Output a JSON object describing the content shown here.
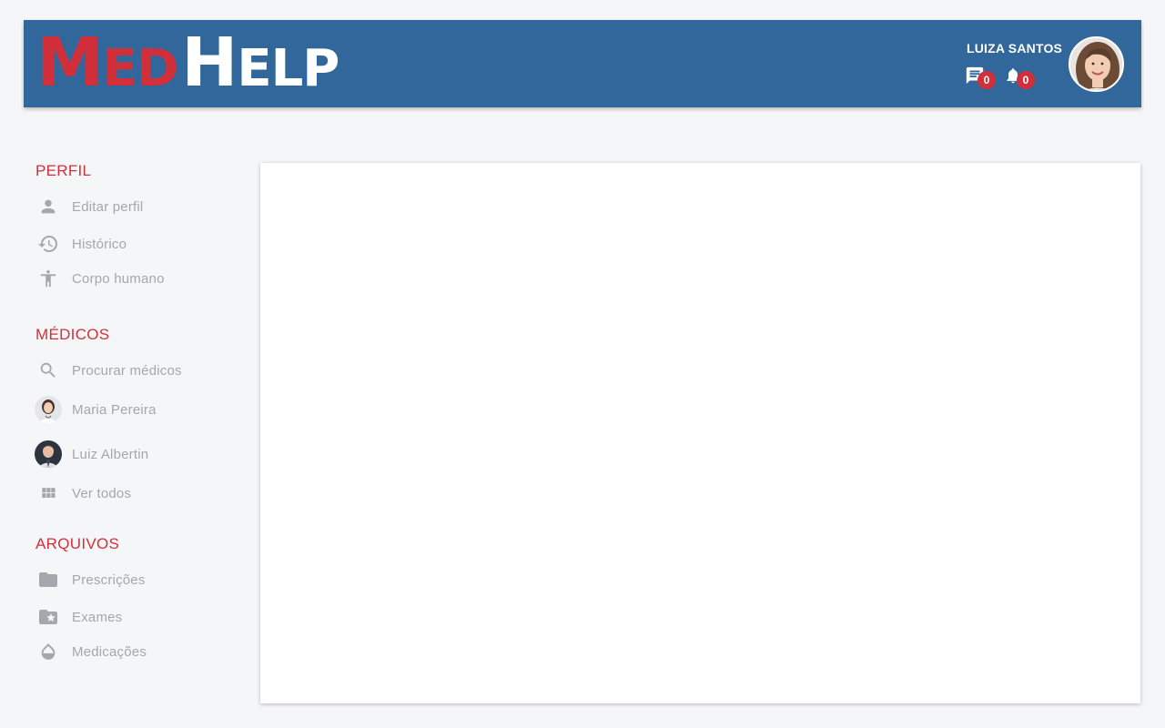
{
  "header": {
    "logo": {
      "part1": "Med",
      "part2": "Help"
    },
    "user_name": "LUIZA SANTOS",
    "messages": {
      "icon": "chat-icon",
      "count": "0"
    },
    "notifications": {
      "icon": "bell-icon",
      "count": "0"
    },
    "avatar": "user-avatar"
  },
  "sidebar": {
    "sections": [
      {
        "title": "PERFIL",
        "items": [
          {
            "label": "Editar perfil",
            "icon": "person-icon"
          },
          {
            "label": "Histórico",
            "icon": "history-icon"
          },
          {
            "label": "Corpo humano",
            "icon": "accessibility-icon"
          }
        ]
      },
      {
        "title": "MÉDICOS",
        "items": [
          {
            "label": "Procurar médicos",
            "icon": "search-icon"
          },
          {
            "label": "Maria Pereira",
            "icon": "doctor-avatar"
          },
          {
            "label": "Luiz Albertin",
            "icon": "doctor-avatar"
          },
          {
            "label": "Ver todos",
            "icon": "grid-icon"
          }
        ]
      },
      {
        "title": "ARQUIVOS",
        "items": [
          {
            "label": "Prescrições",
            "icon": "folder-icon"
          },
          {
            "label": "Exames",
            "icon": "folder-star-icon"
          },
          {
            "label": "Medicações",
            "icon": "drop-icon"
          }
        ]
      }
    ]
  },
  "colors": {
    "header_bg": "#32679b",
    "accent_red": "#d1303a",
    "nav_text": "#a4a7ab",
    "page_bg": "#f5f6f8"
  }
}
